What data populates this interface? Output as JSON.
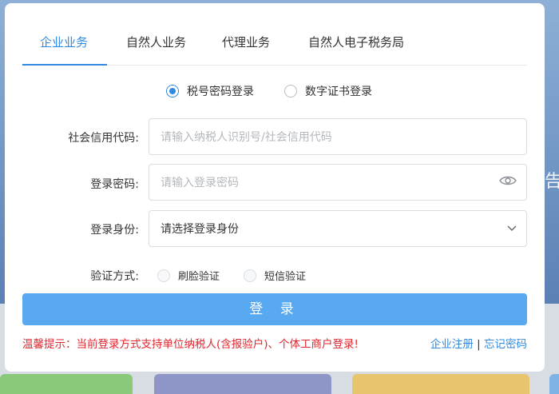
{
  "tabs": [
    {
      "label": "企业业务",
      "active": true
    },
    {
      "label": "自然人业务",
      "active": false
    },
    {
      "label": "代理业务",
      "active": false
    },
    {
      "label": "自然人电子税务局",
      "active": false
    }
  ],
  "login_modes": {
    "password": {
      "label": "税号密码登录",
      "checked": true
    },
    "certificate": {
      "label": "数字证书登录",
      "checked": false
    }
  },
  "form": {
    "credit_code": {
      "label": "社会信用代码:",
      "placeholder": "请输入纳税人识别号/社会信用代码"
    },
    "password": {
      "label": "登录密码:",
      "placeholder": "请输入登录密码"
    },
    "identity": {
      "label": "登录身份:",
      "value": "请选择登录身份"
    },
    "verify": {
      "label": "验证方式:",
      "options": [
        "刷脸验证",
        "短信验证"
      ]
    }
  },
  "login_button": "登 录",
  "tip": "温馨提示：当前登录方式支持单位纳税人(含报验户)、个体工商户登录!",
  "links": {
    "register": "企业注册",
    "separator": "|",
    "forgot": "忘记密码"
  },
  "background": {
    "side_glyph": "告"
  },
  "colors": {
    "accent": "#2f8ae0",
    "button": "#59a9f1",
    "warning": "#e0262e"
  }
}
